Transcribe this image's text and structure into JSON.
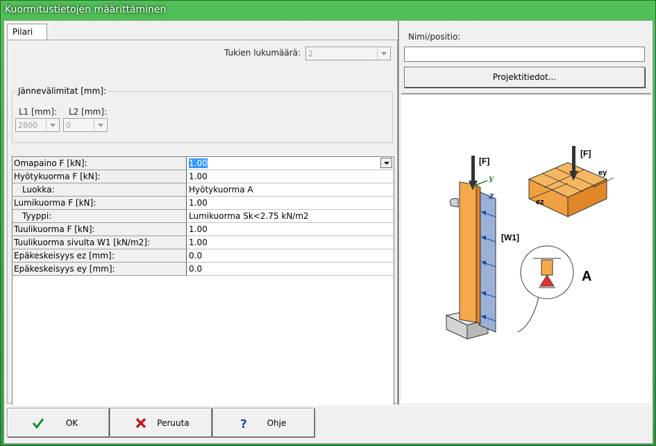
{
  "window": {
    "title": "Kuormitustietojen määrittäminen"
  },
  "tab": {
    "label": "Pilari"
  },
  "supports": {
    "label": "Tukien lukumäärä:",
    "value": "2"
  },
  "spans": {
    "title": "Jännevälimitat [mm]:",
    "l1_label": "L1 [mm]:",
    "l1_value": "2800",
    "l2_label": "L2 [mm]:",
    "l2_value": "0"
  },
  "grid": {
    "rows": [
      {
        "name": "Omapaino F [kN]:",
        "value": "1.00"
      },
      {
        "name": "Hyötykuorma F [kN]:",
        "value": "1.00"
      },
      {
        "name": "Luokka:",
        "value": "Hyötykuorma A"
      },
      {
        "name": "Lumikuorma F [kN]:",
        "value": "1.00"
      },
      {
        "name": "Tyyppi:",
        "value": "Lumikuorma Sk<2.75 kN/m2"
      },
      {
        "name": "Tuulikuorma F [kN]:",
        "value": "1.00"
      },
      {
        "name": "Tuulikuorma sivulta W1 [kN/m2]:",
        "value": "1.00"
      },
      {
        "name": "Epäkeskeisyys ez [mm]:",
        "value": "0.0"
      },
      {
        "name": "Epäkeskeisyys ey [mm]:",
        "value": "0.0"
      }
    ]
  },
  "right": {
    "name_label": "Nimi/positio:",
    "name_value": "",
    "project_button": "Projektitiedot..."
  },
  "figure": {
    "label_F1": "[F]",
    "label_F2": "[F]",
    "label_y": "y",
    "label_z": "z",
    "label_W1": "[W1]",
    "label_ey": "ey",
    "label_ez": "ez",
    "label_A": "A"
  },
  "buttons": {
    "ok": "OK",
    "cancel": "Peruuta",
    "help": "Ohje"
  },
  "colors": {
    "titlebar": "#3aa84a",
    "wood": "#f5a94a",
    "wind": "#9ab0d8",
    "selection": "#3399ff"
  }
}
